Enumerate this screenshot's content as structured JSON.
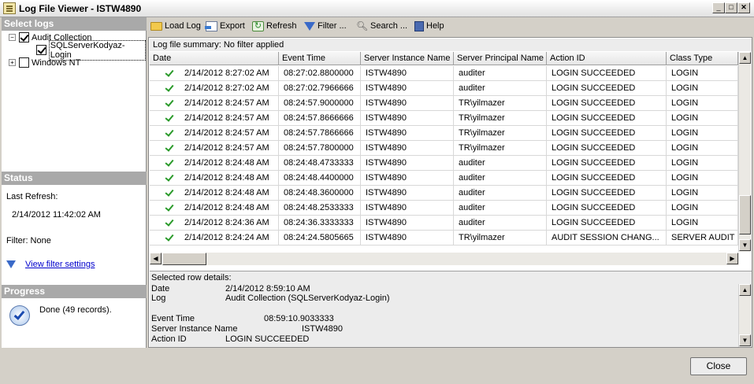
{
  "window": {
    "title": "Log File Viewer - ISTW4890"
  },
  "toolbar": {
    "load_log": "Load Log",
    "export": "Export",
    "refresh": "Refresh",
    "filter": "Filter ...",
    "search": "Search ...",
    "help": "Help"
  },
  "select_logs": {
    "header": "Select logs",
    "items": [
      {
        "label": "Audit Collection",
        "checked": true,
        "expander": "−"
      },
      {
        "label": "SQLServerKodyaz-Login",
        "checked": true
      },
      {
        "label": "Windows NT",
        "checked": false,
        "expander": "+"
      }
    ]
  },
  "status": {
    "header": "Status",
    "last_refresh_label": "Last Refresh:",
    "last_refresh_value": "2/14/2012 11:42:02 AM",
    "filter_label": "Filter: None",
    "view_filter_link": "View filter settings"
  },
  "progress": {
    "header": "Progress",
    "text": "Done (49 records)."
  },
  "summary": "Log file summary: No filter applied",
  "grid": {
    "columns": [
      "Date",
      "Event Time",
      "Server Instance Name",
      "Server Principal Name",
      "Action ID",
      "Class Type"
    ],
    "rows": [
      [
        "2/14/2012 8:27:02 AM",
        "08:27:02.8800000",
        "ISTW4890",
        "auditer",
        "LOGIN SUCCEEDED",
        "LOGIN"
      ],
      [
        "2/14/2012 8:27:02 AM",
        "08:27:02.7966666",
        "ISTW4890",
        "auditer",
        "LOGIN SUCCEEDED",
        "LOGIN"
      ],
      [
        "2/14/2012 8:24:57 AM",
        "08:24:57.9000000",
        "ISTW4890",
        "TR\\yilmazer",
        "LOGIN SUCCEEDED",
        "LOGIN"
      ],
      [
        "2/14/2012 8:24:57 AM",
        "08:24:57.8666666",
        "ISTW4890",
        "TR\\yilmazer",
        "LOGIN SUCCEEDED",
        "LOGIN"
      ],
      [
        "2/14/2012 8:24:57 AM",
        "08:24:57.7866666",
        "ISTW4890",
        "TR\\yilmazer",
        "LOGIN SUCCEEDED",
        "LOGIN"
      ],
      [
        "2/14/2012 8:24:57 AM",
        "08:24:57.7800000",
        "ISTW4890",
        "TR\\yilmazer",
        "LOGIN SUCCEEDED",
        "LOGIN"
      ],
      [
        "2/14/2012 8:24:48 AM",
        "08:24:48.4733333",
        "ISTW4890",
        "auditer",
        "LOGIN SUCCEEDED",
        "LOGIN"
      ],
      [
        "2/14/2012 8:24:48 AM",
        "08:24:48.4400000",
        "ISTW4890",
        "auditer",
        "LOGIN SUCCEEDED",
        "LOGIN"
      ],
      [
        "2/14/2012 8:24:48 AM",
        "08:24:48.3600000",
        "ISTW4890",
        "auditer",
        "LOGIN SUCCEEDED",
        "LOGIN"
      ],
      [
        "2/14/2012 8:24:48 AM",
        "08:24:48.2533333",
        "ISTW4890",
        "auditer",
        "LOGIN SUCCEEDED",
        "LOGIN"
      ],
      [
        "2/14/2012 8:24:36 AM",
        "08:24:36.3333333",
        "ISTW4890",
        "auditer",
        "LOGIN SUCCEEDED",
        "LOGIN"
      ],
      [
        "2/14/2012 8:24:24 AM",
        "08:24:24.5805665",
        "ISTW4890",
        "TR\\yilmazer",
        "AUDIT SESSION CHANG...",
        "SERVER AUDIT"
      ]
    ]
  },
  "details": {
    "header": "Selected row details:",
    "fields": [
      {
        "label": "Date",
        "value": "2/14/2012 8:59:10 AM"
      },
      {
        "label": "Log",
        "value": "Audit Collection (SQLServerKodyaz-Login)"
      },
      {
        "label": "Event Time",
        "value": "08:59:10.9033333"
      },
      {
        "label": "Server Instance Name",
        "value": "ISTW4890"
      },
      {
        "label": "Action ID",
        "value": "LOGIN SUCCEEDED"
      }
    ]
  },
  "buttons": {
    "close": "Close"
  }
}
